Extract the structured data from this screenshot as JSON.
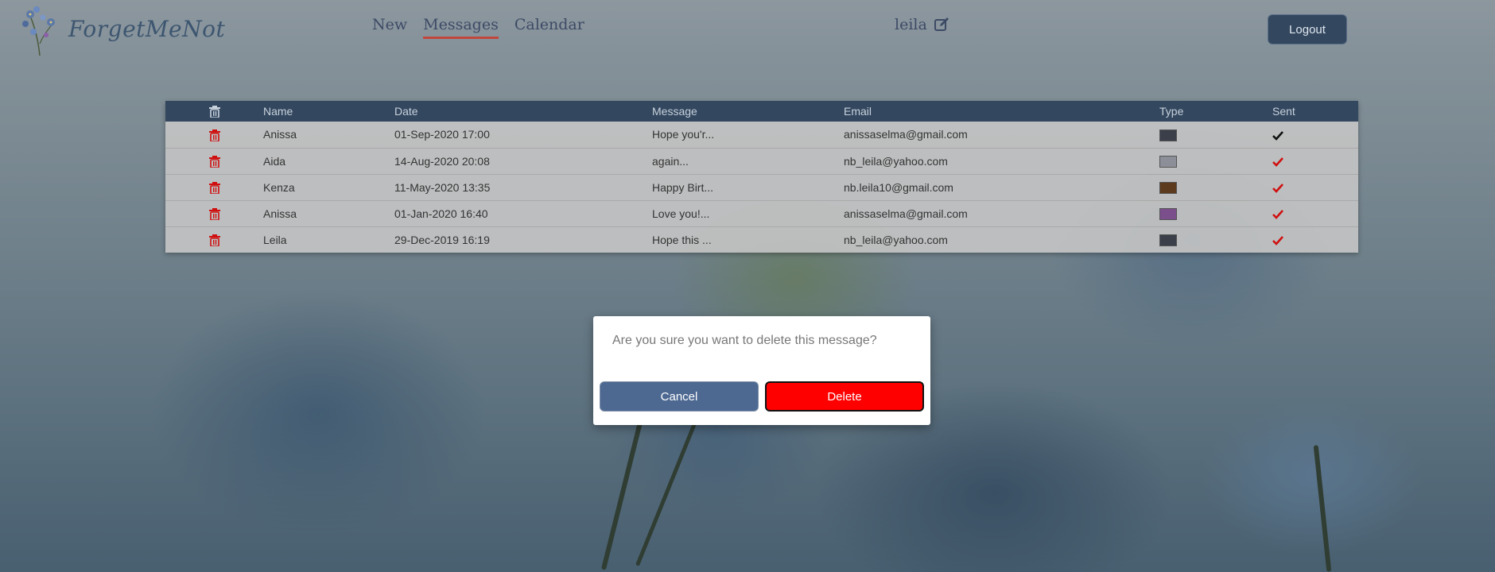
{
  "app": {
    "logo_text": "ForgetMeNot"
  },
  "nav": {
    "items": [
      {
        "label": "New",
        "active": false
      },
      {
        "label": "Messages",
        "active": true
      },
      {
        "label": "Calendar",
        "active": false
      }
    ]
  },
  "user": {
    "name": "leila",
    "edit_icon": "edit-icon"
  },
  "header": {
    "logout_label": "Logout"
  },
  "table": {
    "columns": [
      "",
      "Name",
      "Date",
      "Message",
      "Email",
      "Type",
      "Sent"
    ],
    "rows": [
      {
        "name": "Anissa",
        "date": "01-Sep-2020 17:00",
        "message": "Hope you'r...",
        "email": "anissaselma@gmail.com",
        "thumb_color": "#3a3f4a",
        "sent_color": "#111111"
      },
      {
        "name": "Aida",
        "date": "14-Aug-2020 20:08",
        "message": "again...",
        "email": "nb_leila@yahoo.com",
        "thumb_color": "#8d8f98",
        "sent_color": "#d01010"
      },
      {
        "name": "Kenza",
        "date": "11-May-2020 13:35",
        "message": "Happy Birt...",
        "email": "nb.leila10@gmail.com",
        "thumb_color": "#5b3a1e",
        "sent_color": "#d01010"
      },
      {
        "name": "Anissa",
        "date": "01-Jan-2020 16:40",
        "message": "Love you!...",
        "email": "anissaselma@gmail.com",
        "thumb_color": "#7a4f8c",
        "sent_color": "#d01010"
      },
      {
        "name": "Leila",
        "date": "29-Dec-2019 16:19",
        "message": "Hope this ...",
        "email": "nb_leila@yahoo.com",
        "thumb_color": "#3a3f4a",
        "sent_color": "#d01010"
      }
    ]
  },
  "modal": {
    "text": "Are you sure you want to delete this message?",
    "cancel_label": "Cancel",
    "delete_label": "Delete"
  },
  "colors": {
    "accent": "#33475f",
    "delete_red": "#ff0000",
    "trash_red": "#d01010",
    "nav_underline": "#c0473b",
    "cancel_blue": "#4d6992"
  }
}
